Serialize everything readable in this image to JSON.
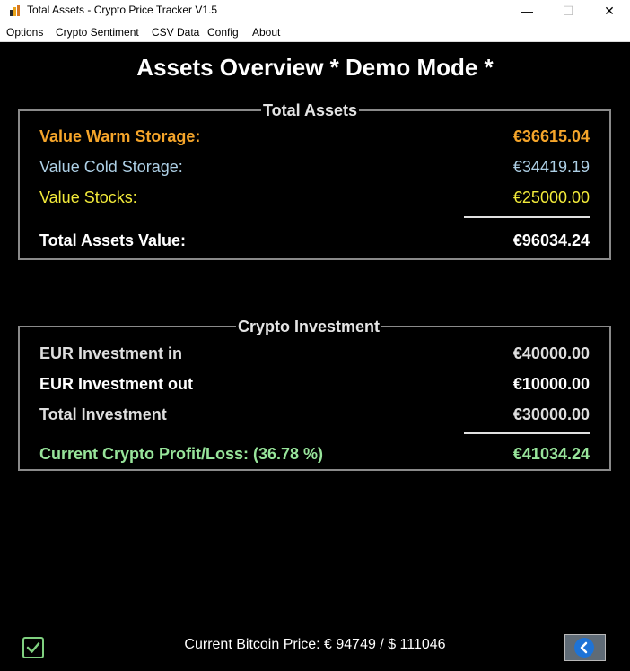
{
  "window": {
    "title": "Total Assets - Crypto Price Tracker V1.5",
    "icon": "app-icon",
    "controls": [
      "minimize-icon",
      "maximize-icon",
      "close-icon"
    ]
  },
  "menu": [
    "Options",
    "Crypto Sentiment",
    "CSV Data",
    "Config",
    "About"
  ],
  "page_title": "Assets Overview * Demo Mode *",
  "total_assets": {
    "label": "Total Assets",
    "rows": [
      {
        "label": "Value Warm Storage:",
        "value": "€36615.04",
        "color": "#f5a52a"
      },
      {
        "label": "Value Cold Storage:",
        "value": "€34419.19",
        "color": "#aed0e6"
      },
      {
        "label": "Value Stocks:",
        "value": "€25000.00",
        "color": "#f2ea3a"
      }
    ],
    "total": {
      "label": "Total Assets Value:",
      "value": "€96034.24"
    }
  },
  "crypto_investment": {
    "label": "Crypto Investment",
    "rows": [
      {
        "label": "EUR Investment in",
        "value": "€40000.00"
      },
      {
        "label": "EUR Investment out",
        "value": "€10000.00"
      },
      {
        "label": "Total Investment",
        "value": "€30000.00"
      }
    ],
    "profit": {
      "label": "Current Crypto Profit/Loss: (36.78 %)",
      "value": "€41034.24",
      "color": "#97e49a"
    }
  },
  "status": {
    "text": "Current Bitcoin Price: € 94749 / $ 111046",
    "checkbox_icon": "checkmark-icon",
    "back_icon": "chevron-left-icon"
  }
}
